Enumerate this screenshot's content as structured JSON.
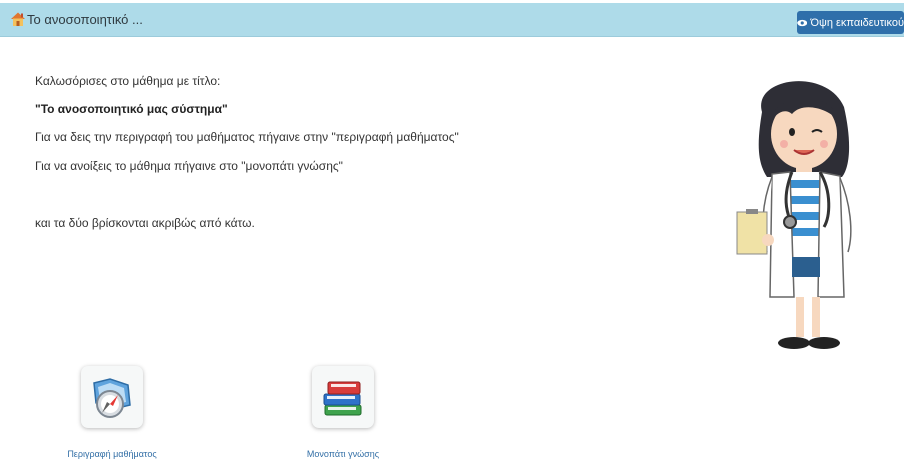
{
  "header": {
    "title": "Το ανοσοποιητικό ...",
    "home_icon": "home-icon",
    "view_button_label": "Όψη εκπαιδευτικού",
    "view_button_icon": "eye-icon"
  },
  "content": {
    "welcome": "Καλωσόρισες στο μάθημα με τίτλο:",
    "course_title": "\"Το ανοσοποιητικό μας σύστημα\"",
    "line_description": "Για να δεις την περιγραφή του μαθήματος πήγαινε στην \"περιγραφή μαθήματος\"",
    "line_path": "Για να ανοίξεις το μάθημα πήγαινε στο \"μονοπάτι γνώσης\"",
    "line_below": "και τα δύο βρίσκονται ακριβώς από κάτω."
  },
  "tiles": [
    {
      "label": "Περιγραφή μαθήματος",
      "icon": "compass-map-icon"
    },
    {
      "label": "Μονοπάτι γνώσης",
      "icon": "books-icon"
    }
  ],
  "colors": {
    "header_bg": "#aedbe9",
    "button_bg": "#2f6faa",
    "link": "#336fa6"
  }
}
